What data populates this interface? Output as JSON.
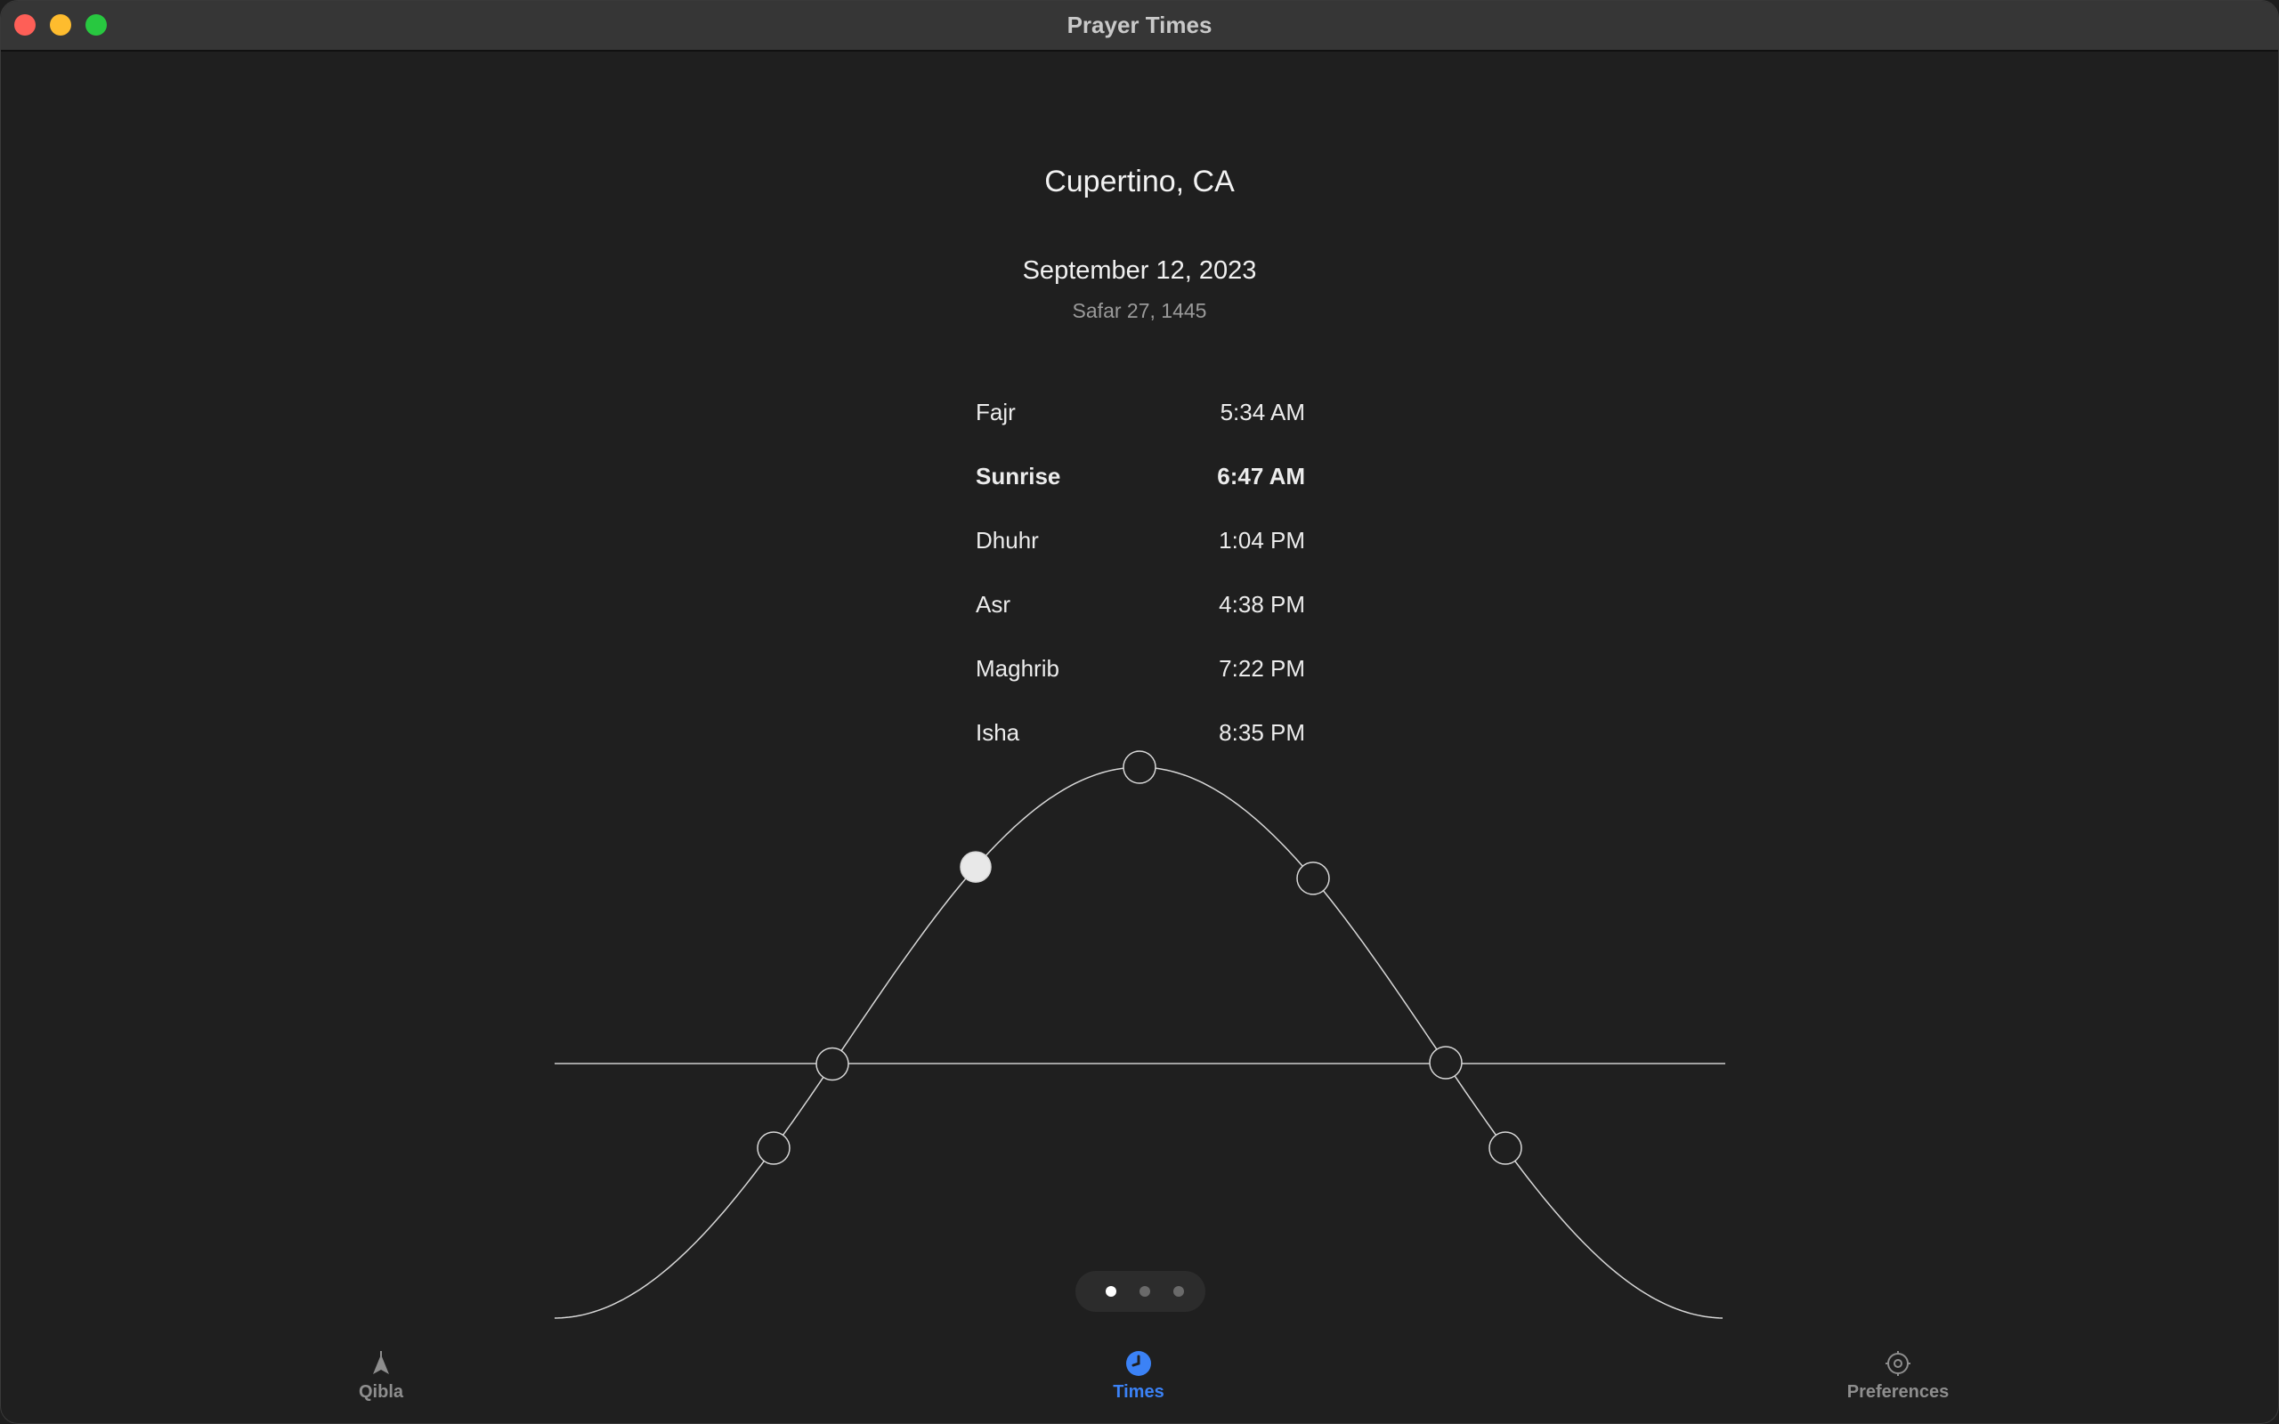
{
  "window": {
    "title": "Prayer Times"
  },
  "location": "Cupertino, CA",
  "date": {
    "gregorian": "September 12, 2023",
    "hijri": "Safar 27, 1445"
  },
  "prayers": [
    {
      "name": "Fajr",
      "time": "5:34 AM",
      "current": false
    },
    {
      "name": "Sunrise",
      "time": "6:47 AM",
      "current": true
    },
    {
      "name": "Dhuhr",
      "time": "1:04 PM",
      "current": false
    },
    {
      "name": "Asr",
      "time": "4:38 PM",
      "current": false
    },
    {
      "name": "Maghrib",
      "time": "7:22 PM",
      "current": false
    },
    {
      "name": "Isha",
      "time": "8:35 PM",
      "current": false
    }
  ],
  "pager": {
    "pages": 3,
    "current_page": 1
  },
  "tabs": [
    {
      "label": "Qibla",
      "icon": "compass-arrow-icon",
      "active": false
    },
    {
      "label": "Times",
      "icon": "clock-icon",
      "active": true
    },
    {
      "label": "Preferences",
      "icon": "gear-icon",
      "active": false
    }
  ],
  "colors": {
    "accent": "#3b82f6",
    "background": "#1f1f1f",
    "titlebar": "#363636",
    "curve": "#d8d8d8"
  }
}
